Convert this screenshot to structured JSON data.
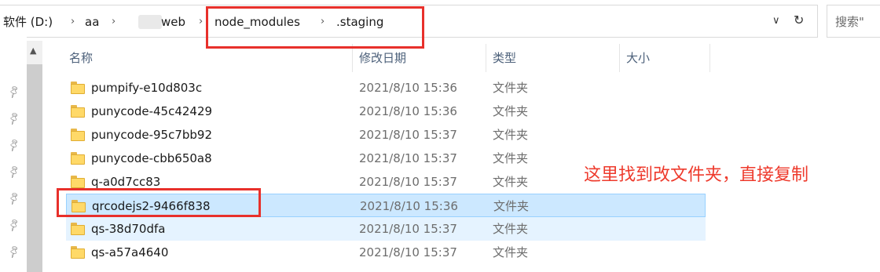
{
  "address_bar": {
    "crumbs": [
      "软件 (D:)",
      "aa",
      "web",
      "node_modules",
      ".staging"
    ],
    "dropdown_icon": "chevron-down-icon",
    "refresh_icon": "refresh-icon"
  },
  "search": {
    "placeholder": "搜索\""
  },
  "columns": {
    "name": "名称",
    "modified": "修改日期",
    "type": "类型",
    "size": "大小"
  },
  "rows": [
    {
      "name": "pumpify-e10d803c",
      "date": "2021/8/10 15:36",
      "type": "文件夹"
    },
    {
      "name": "punycode-45c42429",
      "date": "2021/8/10 15:36",
      "type": "文件夹"
    },
    {
      "name": "punycode-95c7bb92",
      "date": "2021/8/10 15:37",
      "type": "文件夹"
    },
    {
      "name": "punycode-cbb650a8",
      "date": "2021/8/10 15:37",
      "type": "文件夹"
    },
    {
      "name": "q-a0d7cc83",
      "date": "2021/8/10 15:37",
      "type": "文件夹"
    },
    {
      "name": "qrcodejs2-9466f838",
      "date": "2021/8/10 15:36",
      "type": "文件夹",
      "state": "selected"
    },
    {
      "name": "qs-38d70dfa",
      "date": "2021/8/10 15:37",
      "type": "文件夹",
      "state": "hover"
    },
    {
      "name": "qs-a57a4640",
      "date": "2021/8/10 15:37",
      "type": "文件夹"
    }
  ],
  "annotation": {
    "note": "这里找到改文件夹，直接复制",
    "color": "#ee3a2c"
  },
  "colors": {
    "selected_bg": "#cce8ff",
    "hover_bg": "#e5f3ff",
    "header_text": "#4c607a",
    "folder": "#ffd968"
  }
}
